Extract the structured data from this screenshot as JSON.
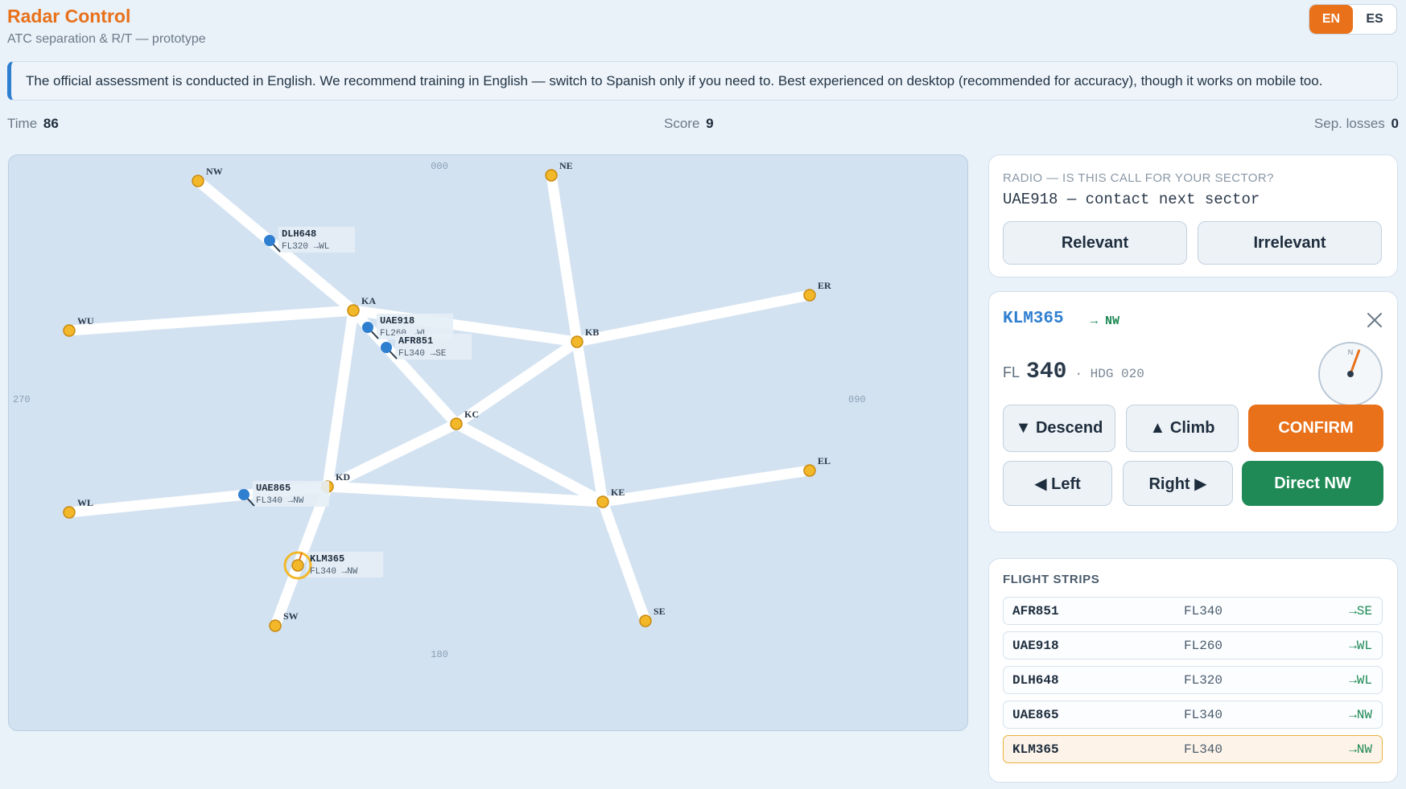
{
  "header": {
    "title": "Radar Control",
    "subtitle": "ATC separation & R/T — prototype",
    "languages": [
      {
        "label": "EN",
        "active": true
      },
      {
        "label": "ES",
        "active": false
      }
    ]
  },
  "notice": "The official assessment is conducted in English. We recommend training in English — switch to Spanish only if you need to. Best experienced on desktop (recommended for accuracy), though it works on mobile too.",
  "stats": {
    "time_label": "Time",
    "time_value": "86",
    "score_label": "Score",
    "score_value": "9",
    "seplosses_label": "Sep. losses",
    "seplosses_value": "0"
  },
  "radar": {
    "bearings": {
      "north": "000",
      "east": "090",
      "south": "180",
      "west": "270"
    },
    "fixes": [
      {
        "name": "NW"
      },
      {
        "name": "NE"
      },
      {
        "name": "WU"
      },
      {
        "name": "KA"
      },
      {
        "name": "KB"
      },
      {
        "name": "ER"
      },
      {
        "name": "KC"
      },
      {
        "name": "KD"
      },
      {
        "name": "KE"
      },
      {
        "name": "EL"
      },
      {
        "name": "WL"
      },
      {
        "name": "SW"
      },
      {
        "name": "SE"
      }
    ],
    "routes": [
      [
        "NW",
        "KA"
      ],
      [
        "WU",
        "KA"
      ],
      [
        "KA",
        "KB"
      ],
      [
        "KA",
        "KC"
      ],
      [
        "KA",
        "KD"
      ],
      [
        "NE",
        "KB"
      ],
      [
        "KB",
        "ER"
      ],
      [
        "KB",
        "KC"
      ],
      [
        "KB",
        "KE"
      ],
      [
        "KC",
        "KD"
      ],
      [
        "KC",
        "KE"
      ],
      [
        "KD",
        "KE"
      ],
      [
        "KE",
        "EL"
      ],
      [
        "KE",
        "SE"
      ],
      [
        "KD",
        "WL"
      ],
      [
        "KD",
        "SW"
      ]
    ],
    "aircraft": [
      {
        "callsign": "DLH648",
        "info": "FL320 →WL",
        "selected": false
      },
      {
        "callsign": "UAE918",
        "info": "FL260 →WL",
        "selected": false
      },
      {
        "callsign": "AFR851",
        "info": "FL340 →SE",
        "selected": false
      },
      {
        "callsign": "UAE865",
        "info": "FL340 →NW",
        "selected": false
      },
      {
        "callsign": "KLM365",
        "info": "FL340 →NW",
        "selected": true
      }
    ]
  },
  "radio": {
    "heading": "RADIO — IS THIS CALL FOR YOUR SECTOR?",
    "call": "UAE918 — contact next sector",
    "relevant_label": "Relevant",
    "irrelevant_label": "Irrelevant"
  },
  "selected_aircraft": {
    "callsign": "KLM365",
    "destination": "→ NW",
    "fl_label": "FL",
    "fl_value": "340",
    "heading_text": "· HDG 020",
    "heading_deg": 20,
    "compass_north": "N",
    "descend_label": "▼ Descend",
    "climb_label": "▲ Climb",
    "confirm_label": "CONFIRM",
    "left_label": "◀ Left",
    "right_label": "Right ▶",
    "direct_label": "Direct NW"
  },
  "strips": {
    "heading": "FLIGHT STRIPS",
    "items": [
      {
        "callsign": "AFR851",
        "fl": "FL340",
        "dest": "→SE",
        "selected": false
      },
      {
        "callsign": "UAE918",
        "fl": "FL260",
        "dest": "→WL",
        "selected": false
      },
      {
        "callsign": "DLH648",
        "fl": "FL320",
        "dest": "→WL",
        "selected": false
      },
      {
        "callsign": "UAE865",
        "fl": "FL340",
        "dest": "→NW",
        "selected": false
      },
      {
        "callsign": "KLM365",
        "fl": "FL340",
        "dest": "→NW",
        "selected": true
      }
    ]
  },
  "colors": {
    "accent": "#e8711a",
    "direct": "#1f8a55",
    "aircraft": "#2f7fd0",
    "fix": "#f2b82a"
  }
}
